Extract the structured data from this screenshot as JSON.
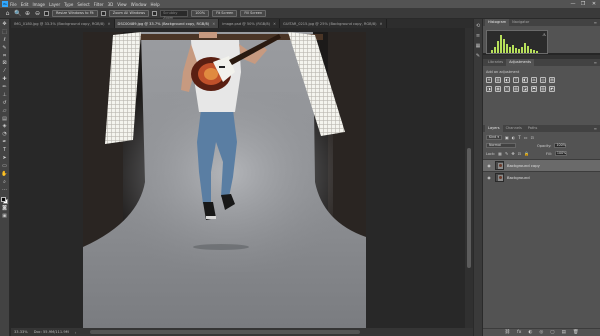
{
  "menubar": {
    "logo": "Ps",
    "items": [
      "File",
      "Edit",
      "Image",
      "Layer",
      "Type",
      "Select",
      "Filter",
      "3D",
      "View",
      "Window",
      "Help"
    ],
    "controls": [
      "—",
      "❐",
      "✕"
    ]
  },
  "options": {
    "resize_label": "Resize Windows to Fit",
    "zoom_all_label": "Zoom All Windows",
    "scrubby_label": "Scrubby Zoom",
    "percent": "100%",
    "fit_label": "Fit Screen",
    "fill_label": "Fill Screen"
  },
  "tabs": [
    {
      "label": "IMG_0180.jpg @ 33.3% (Background copy, RGB/8)",
      "active": false
    },
    {
      "label": "DSC00489.jpg @ 33.7% (Background copy, RGB/8)",
      "active": true
    },
    {
      "label": "image.psd @ 50% (RGB/8)",
      "active": false
    },
    {
      "label": "GUITAR_0215.jpg @ 25% (Background copy, RGB/8)",
      "active": false
    }
  ],
  "status": {
    "zoom": "33.33%",
    "doc": "Doc: 55.9M/111.9M"
  },
  "panels": {
    "top_tabs": [
      "Histogram",
      "Navigator"
    ],
    "adj_tabs": [
      "Libraries",
      "Adjustments"
    ],
    "adj_label": "Add an adjustment",
    "adj_icons": [
      "☀",
      "▥",
      "◐",
      "▽",
      "◧",
      "⚖",
      "◎",
      "▤",
      "◑",
      "▦",
      "◫",
      "▧",
      "◪",
      "⬒",
      "▨",
      "◩"
    ],
    "layer_tabs": [
      "Layers",
      "Channels",
      "Paths"
    ],
    "kind_label": "Kind",
    "blend_mode": "Normal",
    "opacity_label": "Opacity:",
    "opacity_value": "100%",
    "lock_label": "Lock:",
    "fill_label": "Fill:",
    "fill_value": "100%",
    "layers": [
      {
        "name": "Background copy",
        "selected": true
      },
      {
        "name": "Background",
        "selected": false
      }
    ],
    "footer_icons": [
      "⛓",
      "fx",
      "◐",
      "◎",
      "▢",
      "▤",
      "🗑"
    ]
  },
  "colors": {
    "accent": "#31a8ff",
    "histogram": "#b7e05a"
  }
}
